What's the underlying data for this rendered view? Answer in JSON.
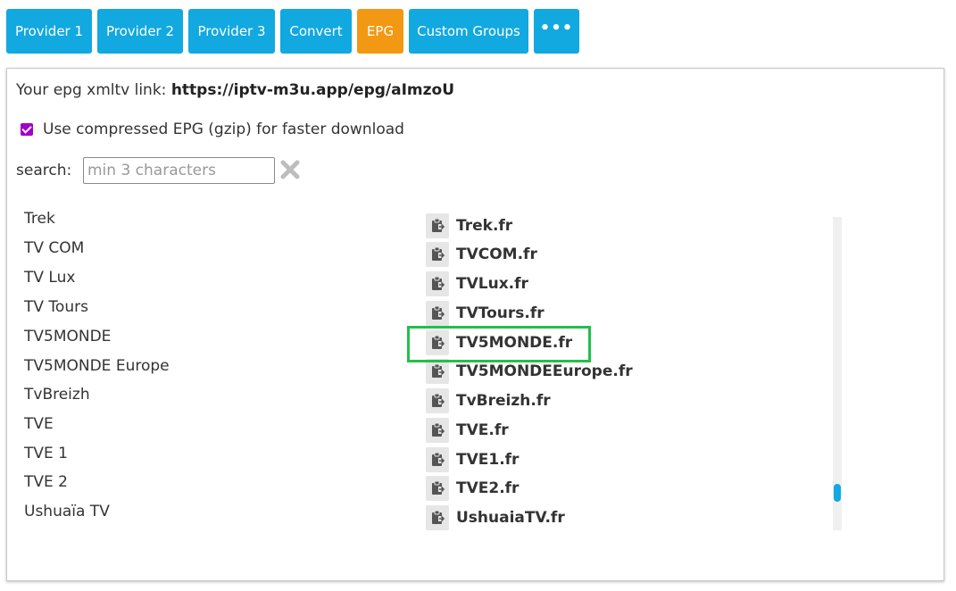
{
  "nav": {
    "buttons": [
      {
        "label": "Provider 1",
        "color": "#12a8e0"
      },
      {
        "label": "Provider 2",
        "color": "#12a8e0"
      },
      {
        "label": "Provider 3",
        "color": "#12a8e0"
      },
      {
        "label": "Convert",
        "color": "#12a8e0"
      },
      {
        "label": "EPG",
        "color": "#f39812",
        "active": true
      },
      {
        "label": "Custom Groups",
        "color": "#12a8e0"
      },
      {
        "label": "•••",
        "color": "#12a8e0"
      }
    ]
  },
  "epg": {
    "link_label": "Your epg xmltv link: ",
    "link_url": "https://iptv-m3u.app/epg/aImzoU",
    "gzip_checked": true,
    "gzip_label": "Use compressed EPG (gzip) for faster download"
  },
  "search": {
    "label": "search:",
    "placeholder": "min 3 characters",
    "clear_icon": "close-x-icon"
  },
  "channels": [
    {
      "name": "Trek",
      "id": "Trek.fr"
    },
    {
      "name": "TV COM",
      "id": "TVCOM.fr"
    },
    {
      "name": "TV Lux",
      "id": "TVLux.fr"
    },
    {
      "name": "TV Tours",
      "id": "TVTours.fr"
    },
    {
      "name": "TV5MONDE",
      "id": "TV5MONDE.fr",
      "highlighted": true
    },
    {
      "name": "TV5MONDE Europe",
      "id": "TV5MONDEEurope.fr"
    },
    {
      "name": "TvBreizh",
      "id": "TvBreizh.fr"
    },
    {
      "name": "TVE",
      "id": "TVE.fr"
    },
    {
      "name": "TVE 1",
      "id": "TVE1.fr"
    },
    {
      "name": "TVE 2",
      "id": "TVE2.fr"
    },
    {
      "name": "Ushuaïa TV",
      "id": "UshuaiaTV.fr"
    }
  ],
  "icons": {
    "copy": "clipboard-copy-icon"
  },
  "colors": {
    "accent": "#12a8e0",
    "active_tab": "#f39812",
    "highlight": "#22c04a",
    "checkbox": "#a000c8"
  }
}
